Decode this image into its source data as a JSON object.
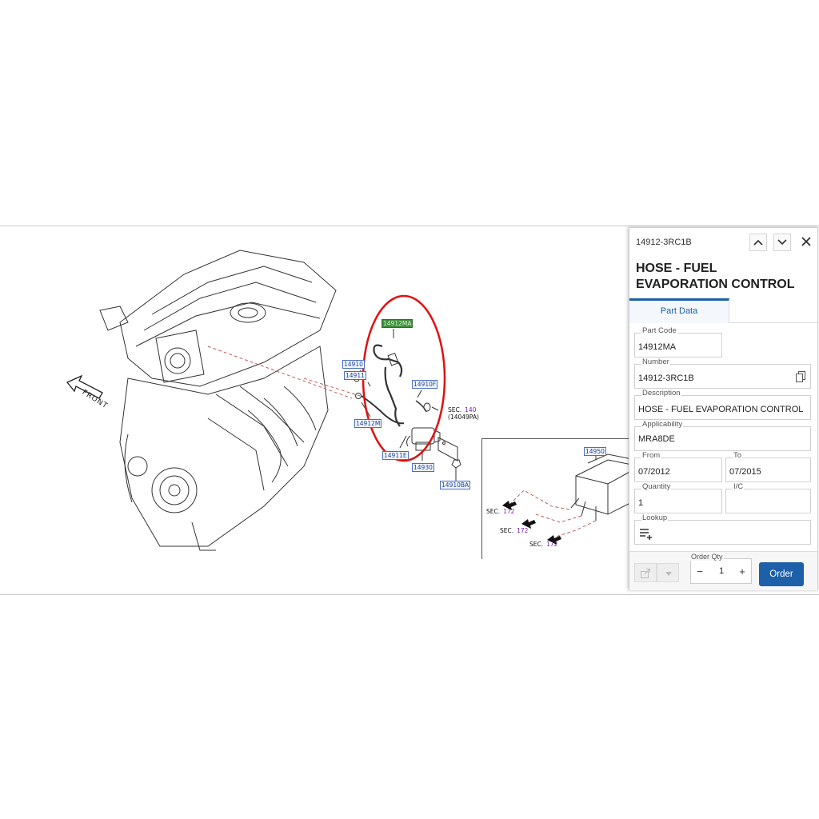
{
  "diagram": {
    "callouts": {
      "c14912ma": "14912MA",
      "c14910": "14910",
      "c14911": "14911",
      "c14912m": "14912M",
      "c14910f": "14910F",
      "c14911e": "14911E",
      "c14930": "14930",
      "c14910ba": "14910BA",
      "c14950": "14950"
    },
    "front_label": "FRONT",
    "sec140": {
      "prefix": "SEC.",
      "num": "140",
      "sub": "(14049PA)"
    },
    "sec172": {
      "prefix": "SEC.",
      "num": "172"
    }
  },
  "panel": {
    "part_code_header": "14912-3RC1B",
    "title": "HOSE - FUEL EVAPORATION CONTROL",
    "tab_part_data": "Part Data",
    "fields": {
      "part_code": {
        "label": "Part Code",
        "value": "14912MA"
      },
      "number": {
        "label": "Number",
        "value": "14912-3RC1B"
      },
      "description": {
        "label": "Description",
        "value": "HOSE - FUEL EVAPORATION CONTROL"
      },
      "applicability": {
        "label": "Applicability",
        "value": "MRA8DE"
      },
      "from": {
        "label": "From",
        "value": "07/2012"
      },
      "to": {
        "label": "To",
        "value": "07/2015"
      },
      "quantity": {
        "label": "Quantity",
        "value": "1"
      },
      "ic": {
        "label": "I/C",
        "value": ""
      },
      "lookup": {
        "label": "Lookup"
      }
    },
    "order_qty_label": "Order Qty",
    "order_qty_value": "1",
    "minus": "−",
    "plus": "+",
    "order_button": "Order",
    "icons": [
      "chevron-up-icon",
      "chevron-down-icon",
      "close-icon",
      "copy-icon",
      "add-to-list-icon",
      "share-icon",
      "dropdown-arrow-icon"
    ],
    "accent_color": "#1d5fa8",
    "highlight_circle_color": "#e01010"
  }
}
